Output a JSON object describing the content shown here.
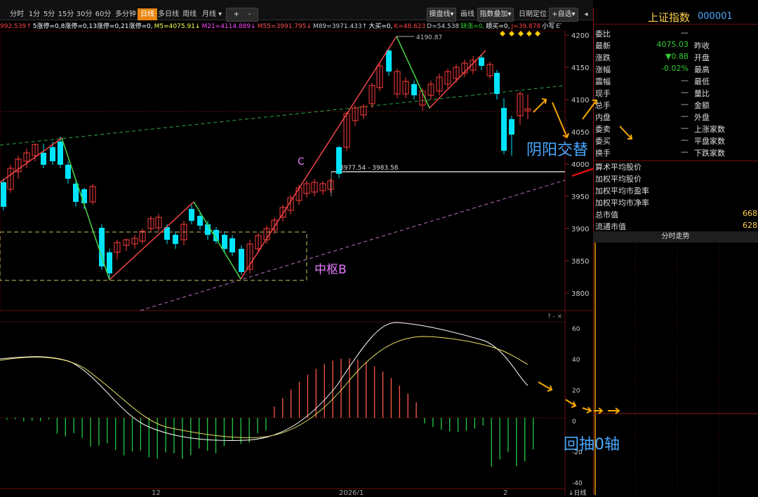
{
  "toolbar": {
    "periods": [
      "分时",
      "1分",
      "5分",
      "15分",
      "30分",
      "60分",
      "多分钟",
      "日线",
      "多日线",
      "周线",
      "月线"
    ],
    "active_period": "日线",
    "zoom_in": "+",
    "zoom_out": "-",
    "right_buttons": [
      "摸盘线",
      "画线",
      "指数叠加",
      "日期定位",
      "+自选"
    ]
  },
  "indicator_line": {
    "parts": [
      {
        "text": "992.539↑",
        "color": "#ff4040"
      },
      {
        "text": "5涨停=0,8涨停=0,13涨停=0,21涨停=0,",
        "color": "#ffffff"
      },
      {
        "text": "M5=4075.91↓",
        "color": "#ffff55"
      },
      {
        "text": "M21=4114.889↓",
        "color": "#ff44ff"
      },
      {
        "text": "M55=3991.795↓",
        "color": "#ff5050"
      },
      {
        "text": "M89=3971.433↑",
        "color": "#cccccc"
      },
      {
        "text": "大买=0,",
        "color": "#ffffff"
      },
      {
        "text": "K=48.623",
        "color": "#ff4040"
      },
      {
        "text": "D=54.538",
        "color": "#cccccc"
      },
      {
        "text": "缺涨=0,",
        "color": "#33cc33"
      },
      {
        "text": "顺买=0,",
        "color": "#ffffff"
      },
      {
        "text": "J=39.878",
        "color": "#ff4040"
      },
      {
        "text": "小写",
        "color": "#ffffff"
      },
      {
        "text": "ETF",
        "color": "#cccccc"
      }
    ]
  },
  "price_axis": [
    "4200",
    "4150",
    "4100",
    "4050",
    "4000",
    "3950",
    "3900",
    "3850",
    "3800"
  ],
  "macd_axis": [
    "60",
    "40",
    "20",
    "0",
    "-20",
    "-40"
  ],
  "date_labels": [
    "12",
    "2026/1",
    "2"
  ],
  "chart_labels": {
    "high_value": "4190.87",
    "range_label": "3977.54 - 3983.58",
    "c_label": "C",
    "zhongshu": "中枢B"
  },
  "panel_controls": "? - ×",
  "right_panel": {
    "title": "上证指数",
    "code": "000001",
    "rows": [
      {
        "label": "委比",
        "value": "—",
        "label2": "",
        "value2": ""
      },
      {
        "label": "最新",
        "value": "4075.03",
        "value_color": "#33cc33",
        "label2": "昨收",
        "value2": ""
      },
      {
        "label": "涨跌",
        "value": "▼0.88",
        "value_color": "#33cc33",
        "label2": "开盘",
        "value2": ""
      },
      {
        "label": "涨幅",
        "value": "-0.02%",
        "value_color": "#33cc33",
        "label2": "最高",
        "value2": ""
      },
      {
        "label": "震幅",
        "value": "—",
        "label2": "最低",
        "value2": ""
      },
      {
        "label": "现手",
        "value": "—",
        "label2": "量比",
        "value2": ""
      },
      {
        "label": "总手",
        "value": "—",
        "label2": "金额",
        "value2": ""
      },
      {
        "label": "内盘",
        "value": "—",
        "label2": "外盘",
        "value2": ""
      },
      {
        "label": "委卖",
        "value": "—",
        "label2": "上涨家数",
        "value2": ""
      },
      {
        "label": "委买",
        "value": "—",
        "label2": "平盘家数",
        "value2": ""
      },
      {
        "label": "换手",
        "value": "—",
        "label2": "下跌家数",
        "value2": ""
      }
    ],
    "stats": [
      {
        "label": "算术平均股价",
        "value": ""
      },
      {
        "label": "加权平均股价",
        "value": ""
      },
      {
        "label": "加权平均市盈率",
        "value": ""
      },
      {
        "label": "加权平均市净率",
        "value": ""
      },
      {
        "label": "总市值",
        "value": "668"
      },
      {
        "label": "流通市值",
        "value": "628"
      }
    ],
    "mini_chart_title": "分时走势"
  },
  "annotations": {
    "yinyang": "阴阳交替",
    "huichou": "回抽0轴"
  },
  "bottom_right": "日线",
  "colors": {
    "up": "#ff3b3b",
    "down": "#00e5ff",
    "ma_green": "#44cc55",
    "accent": "#e8860f",
    "annot": "#4aa8ff",
    "dash_pink": "#c070c0",
    "yellow": "#e8e060"
  }
}
